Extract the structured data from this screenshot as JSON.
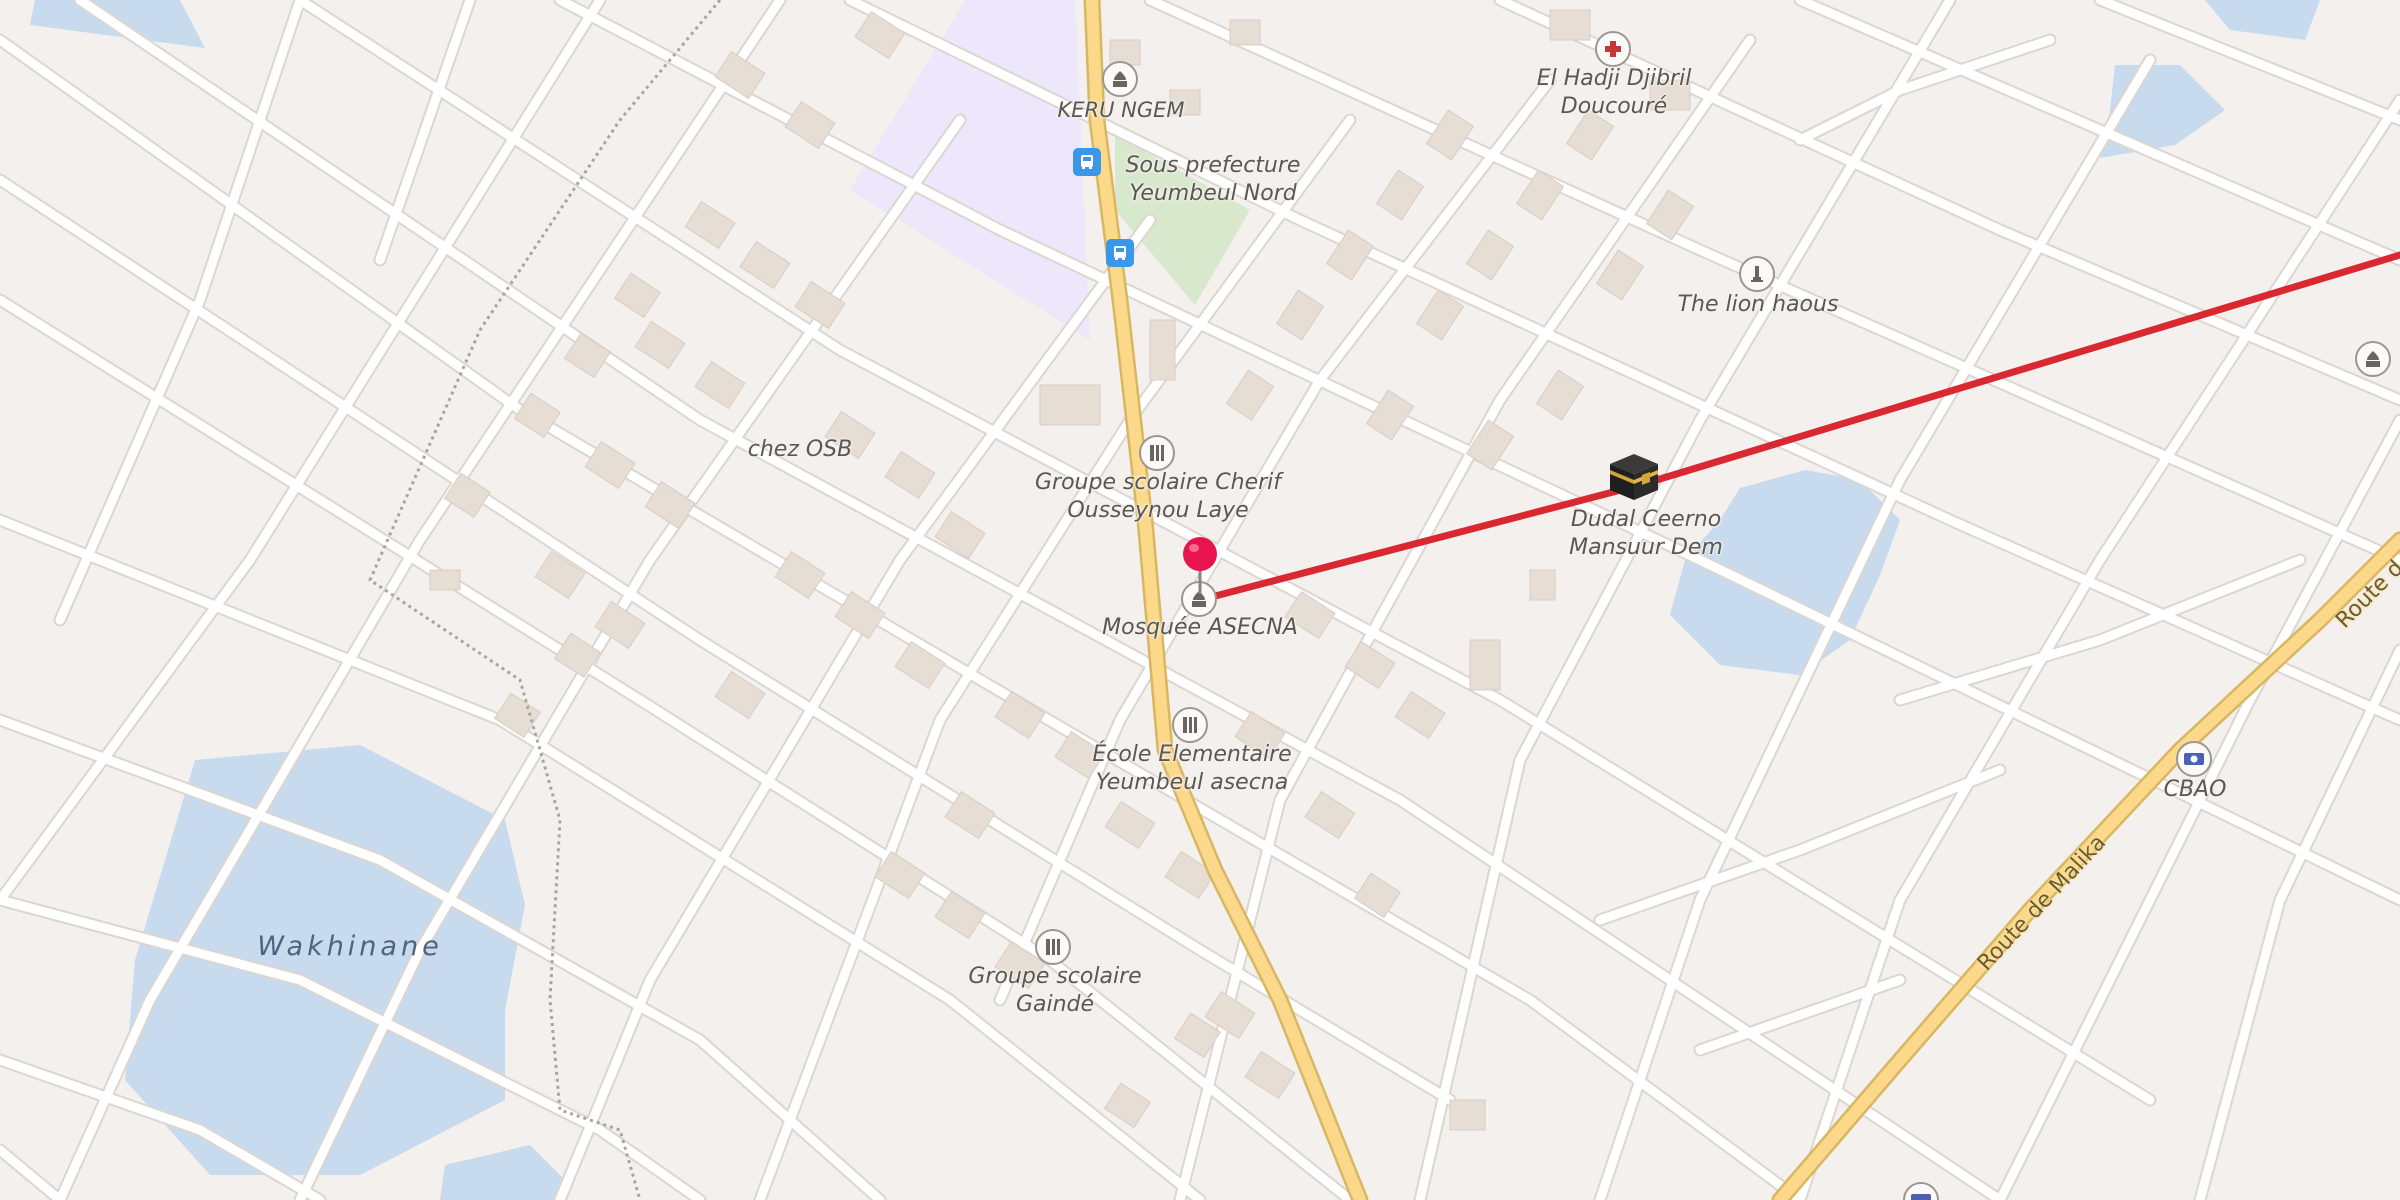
{
  "map": {
    "colors": {
      "land": "#f3f0ed",
      "water": "#c7daee",
      "road": "#ffffff",
      "road_casing": "#dcd6d0",
      "primary_road": "#fbd88a",
      "building": "#e6ddd5",
      "school_area": "#ece7fa",
      "park": "#d8e8cc",
      "route_line": "#d9282f",
      "marker": "#e8144f"
    }
  },
  "places": {
    "keru_ngem": "KERU NGEM",
    "sous_prefecture_l1": "Sous prefecture",
    "sous_prefecture_l2": "Yeumbeul Nord",
    "el_hadji_l1": "El Hadji Djibril",
    "el_hadji_l2": "Doucouré",
    "lion_haous": "The lion haous",
    "chez_osb": "chez OSB",
    "groupe_cherif_l1": "Groupe scolaire Cherif",
    "groupe_cherif_l2": "Ousseynou Laye",
    "dudal_l1": "Dudal Ceerno",
    "dudal_l2": "Mansuur Dem",
    "mosquee": "Mosquée ASECNA",
    "ecole_l1": "École Elementaire",
    "ecole_l2": "Yeumbeul asecna",
    "cbao": "CBAO",
    "gainde_l1": "Groupe scolaire",
    "gainde_l2": "Gaindé",
    "wakhinane": "Wakhinane"
  },
  "roads": {
    "route_malika": "Route de Malika",
    "route_cut": "Route d"
  },
  "icons": {
    "place_of_worship": "mosque-icon",
    "school": "school-icon",
    "hospital": "hospital-icon",
    "monument": "monument-icon",
    "bus_stop": "bus-stop-icon",
    "bank": "bank-icon",
    "destination": "kaaba-icon",
    "pin": "location-pin-icon"
  }
}
